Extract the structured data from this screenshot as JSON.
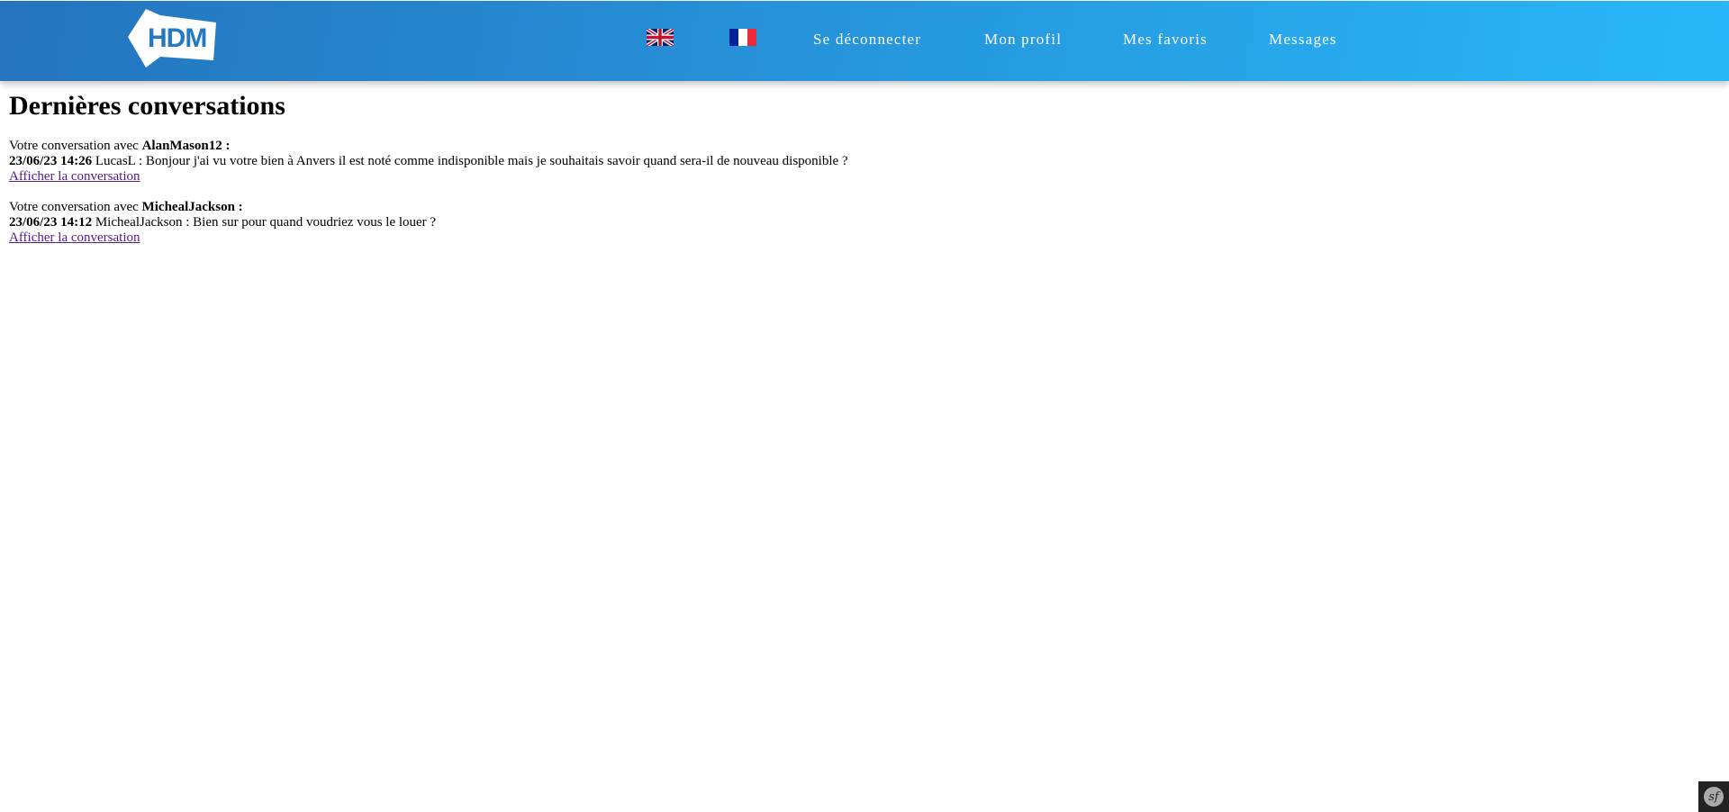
{
  "header": {
    "logo_text": "HDM",
    "languages": [
      {
        "name": "English",
        "icon": "uk-flag-icon"
      },
      {
        "name": "Français",
        "icon": "fr-flag-icon"
      }
    ],
    "nav": [
      "Se déconnecter",
      "Mon profil",
      "Mes favoris",
      "Messages"
    ]
  },
  "main": {
    "title": "Dernières conversations",
    "conversations": [
      {
        "prefix": "Votre conversation avec",
        "user": "AlanMason12 :",
        "timestamp": "23/06/23 14:26",
        "message": "LucasL : Bonjour j'ai vu votre bien à Anvers il est noté comme indisponible mais je souhaitais savoir quand sera-il de nouveau disponible ?",
        "link": "Afficher la conversation"
      },
      {
        "prefix": "Votre conversation avec",
        "user": "MichealJackson :",
        "timestamp": "23/06/23 14:12",
        "message": "MichealJackson : Bien sur pour quand voudriez vous le louer ?",
        "link": "Afficher la conversation"
      }
    ]
  },
  "toolbar": {
    "label": "sf"
  },
  "colors": {
    "header_start": "#2474bd",
    "header_end": "#28b8fa",
    "link": "#551a8b"
  }
}
